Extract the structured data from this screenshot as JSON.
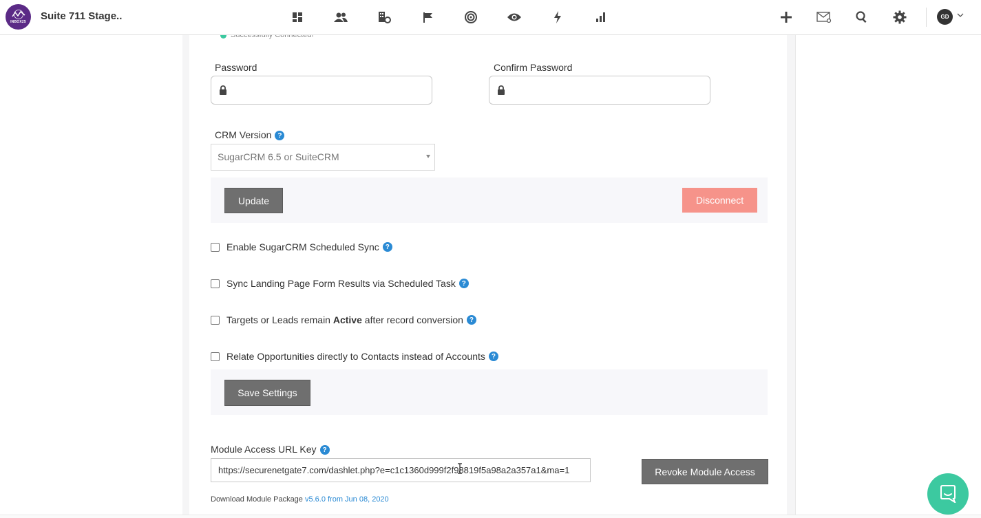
{
  "app": {
    "title": "Suite 711 Stage..",
    "logo_text": "INBOX25",
    "avatar_initials": "GD"
  },
  "nav_icons": [
    "dashboard-icon",
    "contacts-icon",
    "companies-icon",
    "campaigns-flag-icon",
    "target-icon",
    "eye-icon",
    "lightning-icon",
    "reports-bar-icon"
  ],
  "right_icons": [
    "plus-icon",
    "mail-icon",
    "search-icon",
    "gear-icon"
  ],
  "status": {
    "connected_text": "Successfully Connected!",
    "dot_color": "#3cc9a0"
  },
  "form": {
    "password_label": "Password",
    "confirm_password_label": "Confirm Password",
    "crm_version_label": "CRM Version",
    "crm_version_value": "SugarCRM 6.5 or SuiteCRM",
    "update_label": "Update",
    "disconnect_label": "Disconnect"
  },
  "settings": {
    "enable_sync": "Enable SugarCRM Scheduled Sync",
    "sync_landing": "Sync Landing Page Form Results via Scheduled Task",
    "targets_prefix": "Targets or Leads remain ",
    "targets_bold": "Active",
    "targets_suffix": " after record conversion",
    "relate_opps": "Relate Opportunities directly to Contacts instead of Accounts",
    "save_label": "Save Settings"
  },
  "module": {
    "label": "Module Access URL Key",
    "url": "https://securenetgate7.com/dashlet.php?e=c1c1360d999f2f98819f5a98a2a357a1&ma=1",
    "revoke_label": "Revoke Module Access",
    "download_prefix": "Download Module Package ",
    "download_link": "v5.6.0 from Jun 08, 2020"
  },
  "colors": {
    "accent": "#2a8ad4",
    "brand": "#5b2a86",
    "disconnect": "#f6938a",
    "chat": "#3cc9a0"
  }
}
